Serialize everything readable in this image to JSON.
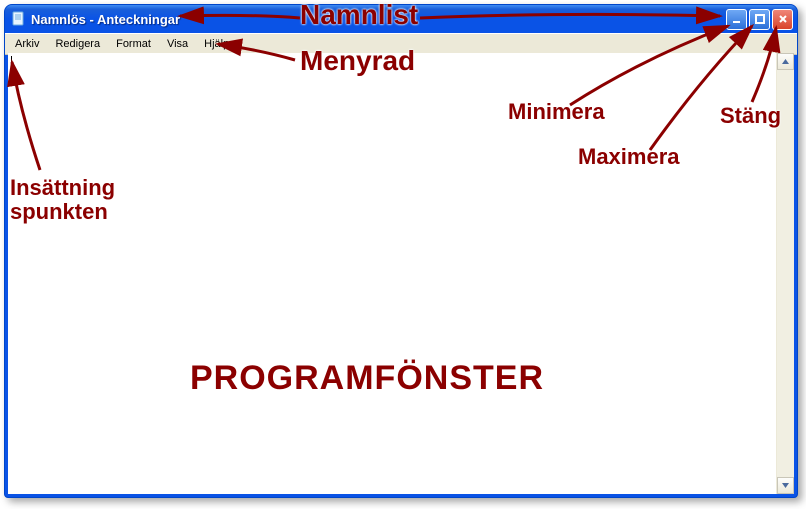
{
  "titlebar": {
    "title": "Namnlös - Anteckningar"
  },
  "menubar": {
    "items": [
      "Arkiv",
      "Redigera",
      "Format",
      "Visa",
      "Hjälp"
    ]
  },
  "textarea": {
    "value": ""
  },
  "annotations": {
    "namnlist": "Namnlist",
    "menyrad": "Menyrad",
    "minimera": "Minimera",
    "maximera": "Maximera",
    "stang": "Stäng",
    "insattningspunkten": "Insättning\nspunkten",
    "programfonster": "PROGRAMFÖNSTER"
  }
}
